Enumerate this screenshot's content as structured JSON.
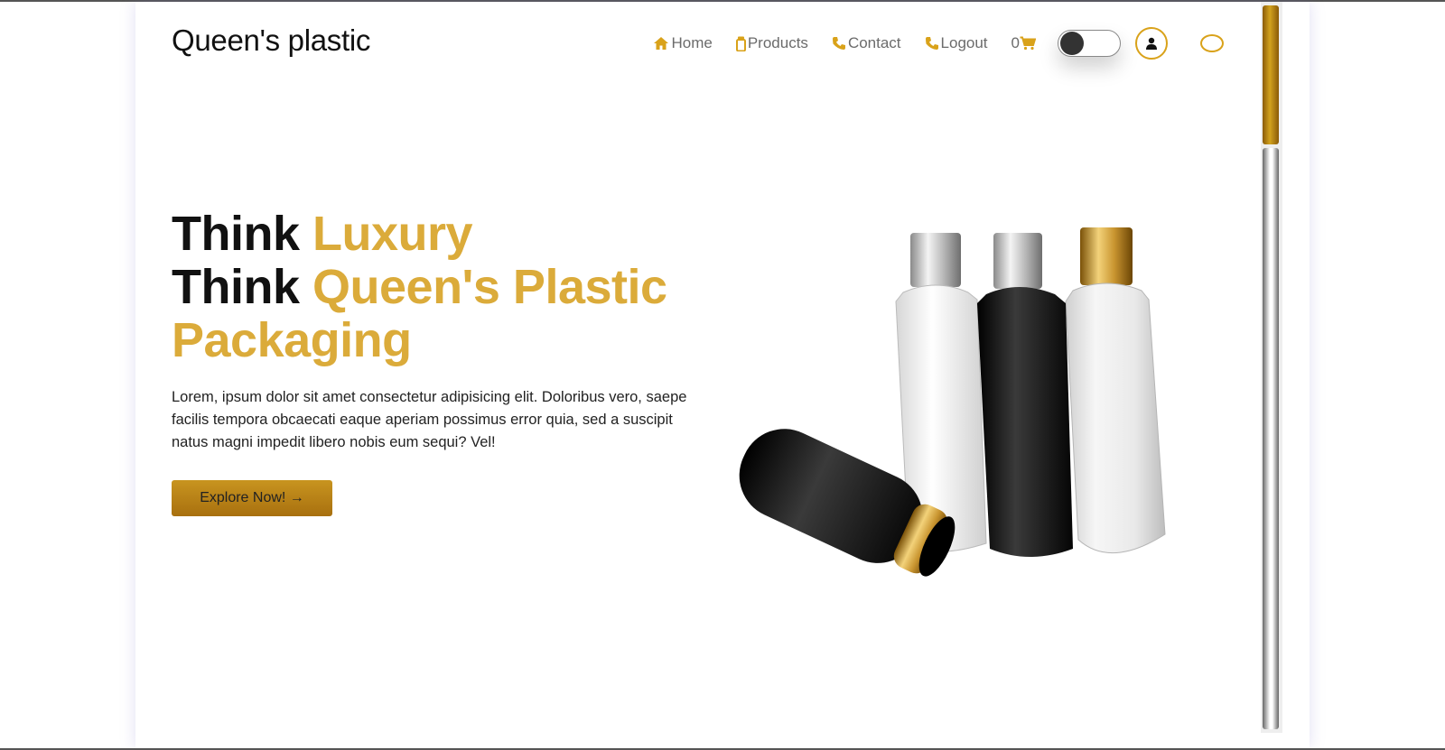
{
  "brand": {
    "name": "Queen's plastic"
  },
  "nav": {
    "items": [
      {
        "label": "Home",
        "icon": "home-icon"
      },
      {
        "label": "Products",
        "icon": "bottle-icon"
      },
      {
        "label": "Contact",
        "icon": "phone-icon"
      },
      {
        "label": "Logout",
        "icon": "phone-icon"
      }
    ],
    "cart_count": "0",
    "cart_icon": "cart-icon",
    "user_icon": "user-icon"
  },
  "hero": {
    "line1_prefix": "Think",
    "line1_highlight": "Luxury",
    "line2_prefix": "Think",
    "line2_highlight": "Queen's Plastic",
    "line3_highlight": "Packaging",
    "description": "Lorem, ipsum dolor sit amet consectetur adipisicing elit. Doloribus vero, saepe facilis tempora obcaecati eaque aperiam possimus error quia, sed a suscipit natus magni impedit libero nobis eum sequi? Vel!",
    "cta_label": "Explore Now! →"
  },
  "colors": {
    "accent": "#d9a21a",
    "gold_text": "#dbab3a",
    "button_gradient_top": "#c8941f",
    "button_gradient_bottom": "#a8700f"
  }
}
